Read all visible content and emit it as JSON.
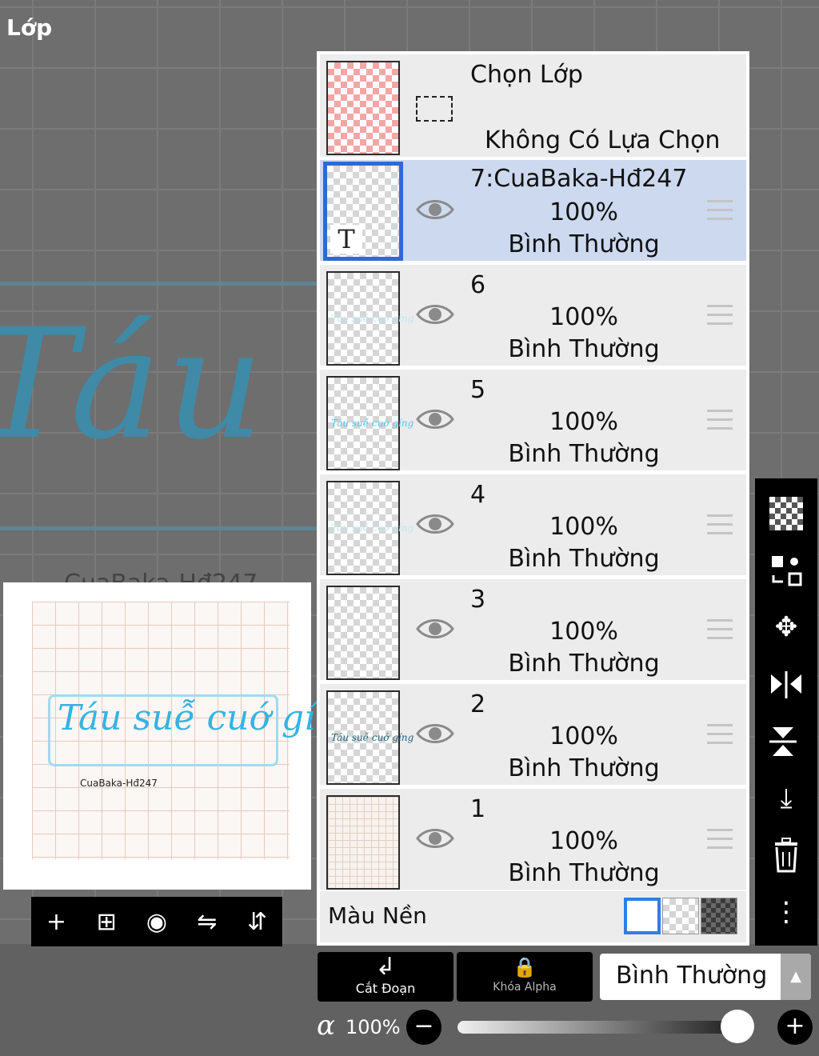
{
  "title": "Lớp",
  "canvas": {
    "script_text": "Táu suễ",
    "caption": "CuaBaka-Hđ247"
  },
  "preview": {
    "script_text": "Táu suễ cuớ gíng",
    "credit": "CuaBaka-Hđ247"
  },
  "preview_toolbar": {
    "add_icon": "+",
    "add_layer_icon": "⊞",
    "camera_icon": "◉",
    "flip_icon": "⇋",
    "flip_v_icon": "⇵"
  },
  "selection_layer": {
    "title": "Chọn Lớp",
    "subtitle": "Không Có Lựa Chọn"
  },
  "layers": [
    {
      "name": "7:CuaBaka-Hđ247",
      "opacity": "100%",
      "mode": "Bình Thường",
      "selected": true
    },
    {
      "name": "6",
      "opacity": "100%",
      "mode": "Bình Thường",
      "selected": false
    },
    {
      "name": "5",
      "opacity": "100%",
      "mode": "Bình Thường",
      "selected": false
    },
    {
      "name": "4",
      "opacity": "100%",
      "mode": "Bình Thường",
      "selected": false
    },
    {
      "name": "3",
      "opacity": "100%",
      "mode": "Bình Thường",
      "selected": false
    },
    {
      "name": "2",
      "opacity": "100%",
      "mode": "Bình Thường",
      "selected": false
    },
    {
      "name": "1",
      "opacity": "100%",
      "mode": "Bình Thường",
      "selected": false
    }
  ],
  "thumb_text_icon": "T",
  "background_color": {
    "label": "Màu Nền"
  },
  "buttons": {
    "clip": "Cắt Đoạn",
    "clip_icon": "↲",
    "alpha_lock": "Khóa Alpha",
    "alpha_lock_icon": "🔒"
  },
  "blend": {
    "value": "Bình Thường",
    "arrow": "▲"
  },
  "alpha": {
    "symbol": "α",
    "value": "100%",
    "level": 1.0,
    "minus": "−",
    "plus": "+"
  },
  "tools": {
    "move": "✥",
    "merge_down": "⤓",
    "trash": "🗑",
    "more": "⋮"
  },
  "colors": {
    "accent": "#2e6ad6",
    "selected_row": "#cdd9ef",
    "row": "#ececec"
  }
}
